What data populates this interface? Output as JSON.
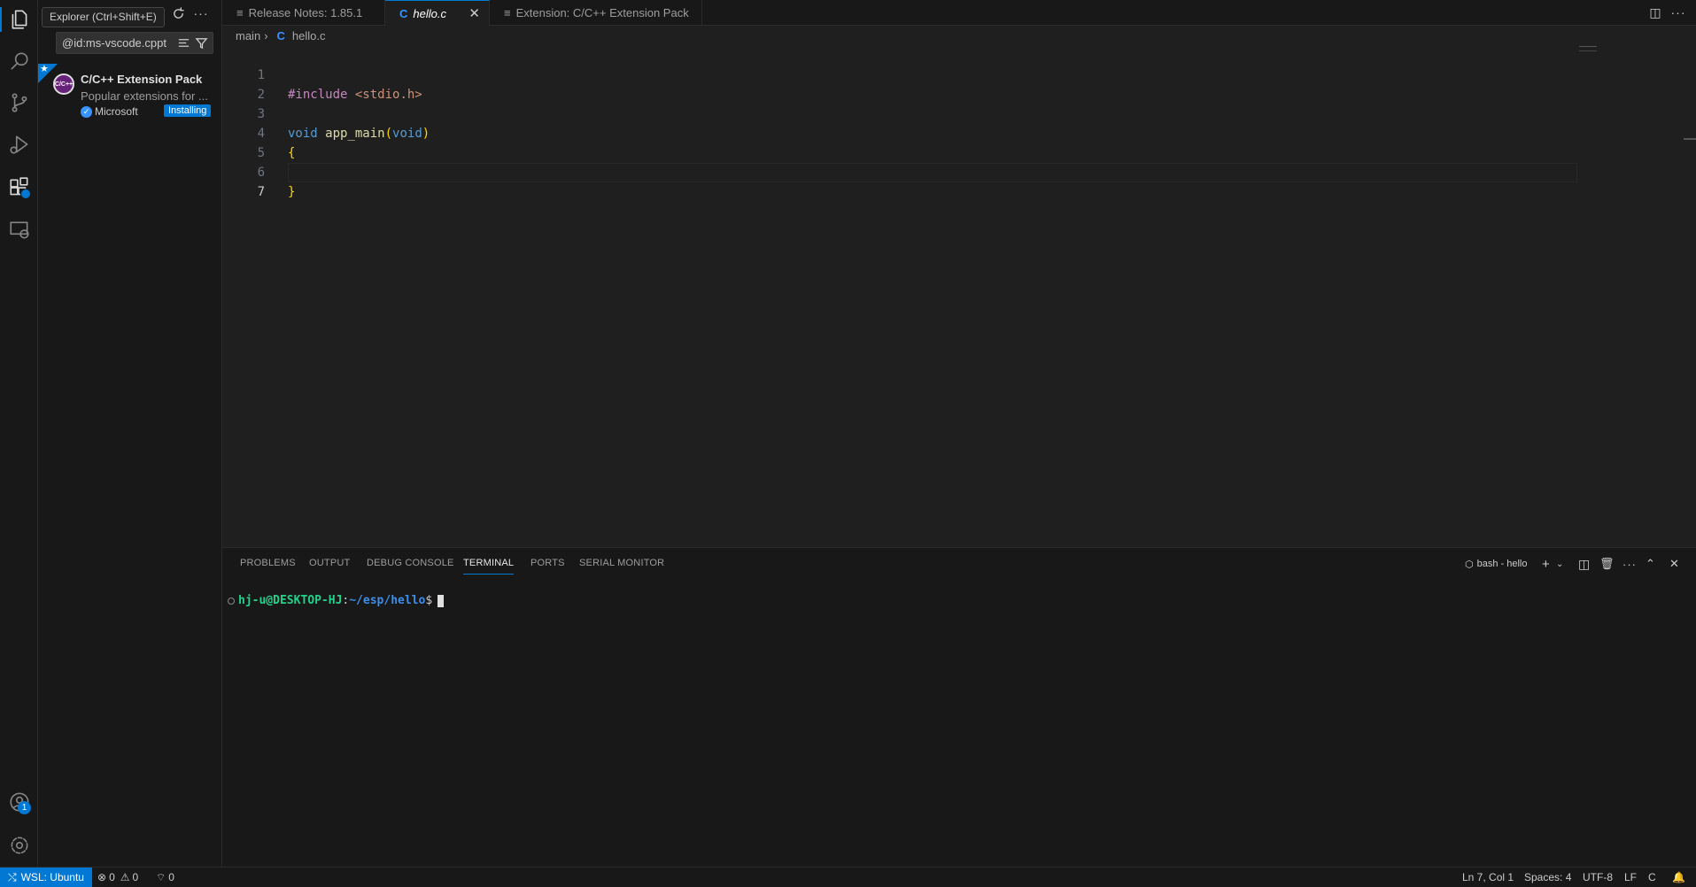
{
  "activity_bar": {
    "items": [
      "files-icon",
      "search-icon",
      "source-control-icon",
      "run-debug-icon",
      "extensions-icon",
      "remote-explorer-icon"
    ],
    "accounts_badge": "1"
  },
  "tooltip": "Explorer (Ctrl+Shift+E)",
  "sidebar": {
    "search_value": "@id:ms-vscode.cppt",
    "extension": {
      "name": "C/C++ Extension Pack",
      "icon_text": "C/C++",
      "description": "Popular extensions for ...",
      "publisher": "Microsoft",
      "status": "Installing"
    }
  },
  "tabs": [
    {
      "label": "Release Notes: 1.85.1",
      "active": false
    },
    {
      "label": "hello.c",
      "active": true,
      "close": "✕"
    },
    {
      "label": "Extension: C/C++ Extension Pack",
      "active": false
    }
  ],
  "breadcrumb": {
    "folder": "main",
    "lang_icon": "C",
    "file": "hello.c"
  },
  "editor": {
    "line_numbers": [
      "1",
      "2",
      "3",
      "4",
      "5",
      "6",
      "7"
    ],
    "current_line": 7
  },
  "panel": {
    "tabs": [
      "PROBLEMS",
      "OUTPUT",
      "DEBUG CONSOLE",
      "TERMINAL",
      "PORTS",
      "SERIAL MONITOR"
    ],
    "active_tab": "TERMINAL",
    "terminal_name": "bash - hello",
    "prompt": {
      "user_host": "hj-u@DESKTOP-HJ",
      "sep": ":",
      "path": "~/esp/hello",
      "symbol": "$"
    }
  },
  "status_bar": {
    "remote": "WSL: Ubuntu",
    "errors": "0",
    "warnings": "0",
    "ports": "0",
    "position": "Ln 7, Col 1",
    "spaces": "Spaces: 4",
    "encoding": "UTF-8",
    "eol": "LF",
    "language": "C"
  },
  "colors": {
    "accent": "#0078d4",
    "background": "#1f1f1f",
    "sidebar": "#181818"
  }
}
